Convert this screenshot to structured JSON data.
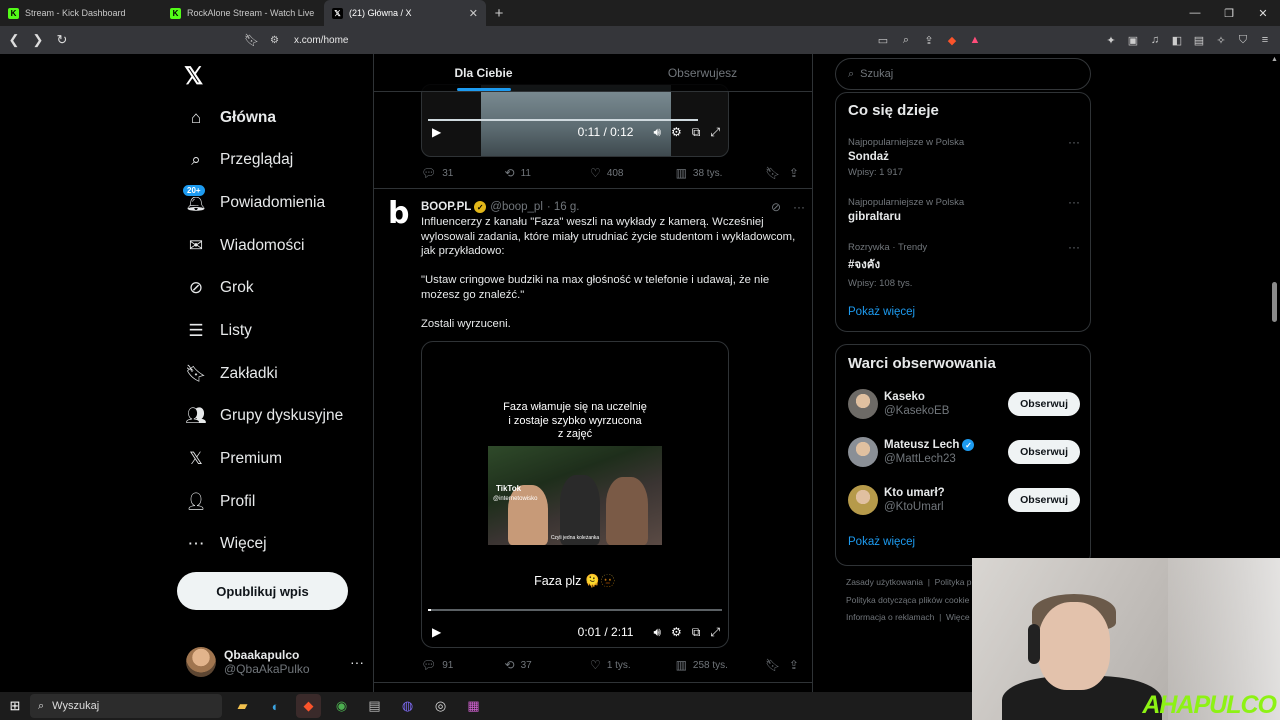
{
  "browser": {
    "tabs": [
      {
        "label": "Stream - Kick Dashboard",
        "active": false
      },
      {
        "label": "RockAlone Stream - Watch Live on Kick",
        "active": false
      },
      {
        "label": "(21) Główna / X",
        "active": true
      }
    ],
    "url": "x.com/home"
  },
  "nav": {
    "items": [
      {
        "label": "Główna",
        "icon": "home-icon"
      },
      {
        "label": "Przeglądaj",
        "icon": "search-icon"
      },
      {
        "label": "Powiadomienia",
        "icon": "bell-icon"
      },
      {
        "label": "Wiadomości",
        "icon": "mail-icon"
      },
      {
        "label": "Grok",
        "icon": "grok-icon"
      },
      {
        "label": "Listy",
        "icon": "list-icon"
      },
      {
        "label": "Zakładki",
        "icon": "bookmark-icon"
      },
      {
        "label": "Grupy dyskusyjne",
        "icon": "communities-icon"
      },
      {
        "label": "Premium",
        "icon": "x-icon"
      },
      {
        "label": "Profil",
        "icon": "person-icon"
      },
      {
        "label": "Więcej",
        "icon": "more-circle-icon"
      }
    ],
    "notif_badge": "20+",
    "post_button": "Opublikuj wpis",
    "profile": {
      "name": "Qbaakapulco",
      "handle": "@QbaAkaPulko"
    }
  },
  "feed": {
    "tabs": [
      "Dla Ciebie",
      "Obserwujesz"
    ],
    "prev_post": {
      "video_time": "0:11 / 0:12",
      "progress": 0.92,
      "replies": "31",
      "reposts": "11",
      "likes": "408",
      "views": "38 tys."
    },
    "post": {
      "name": "BOOP.PL",
      "handle": "@boop_pl",
      "time": "· 16 g.",
      "text1": "Influencerzy z kanału \"Faza\" weszli na wykłady z kamerą. Wcześniej wylosowali zadania, które miały utrudniać życie studentom i wykładowcom, jak przykładowo:",
      "text2": "\"Ustaw cringowe budziki na max głośność w telefonie i udawaj, że nie możesz go znaleźć.\"",
      "text3": "Zostali wyrzuceni.",
      "video_caption": "Faza włamuje się na uczelnię\ni zostaje szybko wyrzucona\nz zajęć",
      "tiktok_label": "TikTok",
      "tiktok_handle": "@internetowisko",
      "thumb_sub": "Czyli jedna koleżanka",
      "video_text": "Faza plz 🫠🫥",
      "video_time": "0:01 / 2:11",
      "progress": 0.01,
      "replies": "91",
      "reposts": "37",
      "likes": "1 tys.",
      "views": "258 tys."
    }
  },
  "sidebar": {
    "search_placeholder": "Szukaj",
    "trends_title": "Co się dzieje",
    "trends": [
      {
        "category": "Najpopularniejsze w Polska",
        "name": "Sondaż",
        "count": "Wpisy: 1 917"
      },
      {
        "category": "Najpopularniejsze w Polska",
        "name": "gibraltaru",
        "count": ""
      },
      {
        "category": "Rozrywka · Trendy",
        "name": "#จงคัง",
        "count": "Wpisy: 108 tys."
      }
    ],
    "show_more": "Pokaż więcej",
    "who_to_follow_title": "Warci obserwowania",
    "follow": [
      {
        "name": "Kaseko",
        "handle": "@KasekoEB",
        "verified": false,
        "button": "Obserwuj",
        "avatar_color": "#6d6a66"
      },
      {
        "name": "Mateusz Lech",
        "handle": "@MattLech23",
        "verified": true,
        "button": "Obserwuj",
        "avatar_color": "#8a8f96"
      },
      {
        "name": "Kto umarł?",
        "handle": "@KtoUmarl",
        "verified": false,
        "button": "Obserwuj",
        "avatar_color": "#b69a4a"
      }
    ],
    "footer_links": [
      "Zasady użytkowania",
      "Polityka p",
      "Polityka dotycząca plików cookie",
      "Informacja o reklamach",
      "Więce"
    ]
  },
  "overlay": {
    "brand": "AHAPULCO"
  },
  "taskbar": {
    "search": "Wyszukaj"
  }
}
